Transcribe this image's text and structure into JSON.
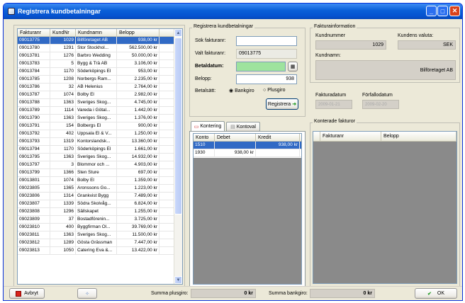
{
  "window": {
    "title": "Registrera kundbetalningar"
  },
  "invoice_list": {
    "headers": [
      "Fakturanr",
      "KundNr",
      "Kundnamn",
      "Belopp"
    ],
    "rows": [
      [
        "09013775",
        "1029",
        "Bilföretaget AB",
        "938,00 kr"
      ],
      [
        "09013780",
        "1291",
        "Stor Stockhol...",
        "562.500,00 kr"
      ],
      [
        "09013781",
        "1276",
        "Barbro Wedding",
        "50.000,00 kr"
      ],
      [
        "09013783",
        "5",
        "Bygg & Trä AB",
        "3.106,00 kr"
      ],
      [
        "09013784",
        "1170",
        "Söderköpings El",
        "953,00 kr"
      ],
      [
        "09013785",
        "1208",
        "Norbergs Ram...",
        "2.235,00 kr"
      ],
      [
        "09013786",
        "32",
        "AB Helenius",
        "2.764,00 kr"
      ],
      [
        "09013787",
        "1074",
        "Bolby El",
        "2.982,00 kr"
      ],
      [
        "09013788",
        "1363",
        "Sveriges Skog...",
        "4.745,00 kr"
      ],
      [
        "09013789",
        "1114",
        "Vareda i Götal...",
        "1.442,00 kr"
      ],
      [
        "09013790",
        "1363",
        "Sveriges Skog...",
        "1.376,00 kr"
      ],
      [
        "09013791",
        "154",
        "Bolbergs El",
        "900,00 kr"
      ],
      [
        "09013792",
        "402",
        "Uppsala El & V...",
        "1.250,00 kr"
      ],
      [
        "09013793",
        "1319",
        "Kontorslandsk...",
        "13.360,00 kr"
      ],
      [
        "09013794",
        "1170",
        "Söderköpings El",
        "1.661,00 kr"
      ],
      [
        "09013795",
        "1363",
        "Sveriges Skog...",
        "14.932,00 kr"
      ],
      [
        "09013797",
        "3",
        "Blommor och ...",
        "4.903,00 kr"
      ],
      [
        "09013799",
        "1366",
        "Sten Sture",
        "697,00 kr"
      ],
      [
        "09013801",
        "1074",
        "Bolby El",
        "1.359,00 kr"
      ],
      [
        "09023805",
        "1365",
        "Aronssons Go...",
        "1.223,00 kr"
      ],
      [
        "09023806",
        "1314",
        "Grankvist Bygg",
        "7.489,00 kr"
      ],
      [
        "09023807",
        "1339",
        "Södra Skolvåg...",
        "6.824,00 kr"
      ],
      [
        "09023808",
        "1296",
        "Sällskapet",
        "1.255,00 kr"
      ],
      [
        "09023809",
        "37",
        "Bostadförenin...",
        "3.725,00 kr"
      ],
      [
        "09023810",
        "400",
        "Byggfirman Ol...",
        "39.769,00 kr"
      ],
      [
        "09023811",
        "1363",
        "Sveriges Skog...",
        "11.500,00 kr"
      ],
      [
        "09023812",
        "1289",
        "Gösta Grässman",
        "7.447,00 kr"
      ],
      [
        "09023813",
        "1050",
        "Catering Eva &...",
        "13.422,00 kr"
      ]
    ]
  },
  "payment": {
    "group_title": "Registrera kundbetalningar",
    "search_label": "Sök fakturanr:",
    "search_value": "",
    "chosen_label": "Valt fakturanr:",
    "chosen_value": "09013775",
    "date_label": "Betaldatum:",
    "amount_label": "Belopp:",
    "amount_value": "938",
    "method_label": "Betalsätt:",
    "method_bankgiro": "Bankgiro",
    "method_plusgiro": "Plusgiro",
    "register_button": "Registrera"
  },
  "invoice_info": {
    "group_title": "Fakturainformation",
    "kundnummer_label": "Kundnummer",
    "kundnummer_value": "1029",
    "valuta_label": "Kundens valuta:",
    "valuta_value": "SEK",
    "kundnamn_label": "Kundnamn:",
    "kundnamn_value": "Bilföretaget AB",
    "fakturadatum_label": "Fakturadatum",
    "fakturadatum_value": "2009-01-21",
    "forfallo_label": "Förfallodatum",
    "forfallo_value": "2009-02-20"
  },
  "tabs": [
    "Kontering",
    "Kontoval"
  ],
  "kontering": {
    "headers": [
      "Konto",
      "Debet",
      "Kredit"
    ],
    "rows": [
      [
        "1510",
        "",
        "938,00 kr"
      ],
      [
        "1930",
        "938,00 kr",
        ""
      ]
    ]
  },
  "konterade": {
    "group_title": "Konterade fakturor",
    "headers": [
      "Fakturanr",
      "Belopp"
    ]
  },
  "bottom": {
    "cancel_label": "Avbryt",
    "sum_plusgiro_label": "Summa plusgiro:",
    "sum_plusgiro_value": "0 kr",
    "sum_bankgiro_label": "Summa bankgiro:",
    "sum_bankgiro_value": "0 kr",
    "ok_label": "OK"
  }
}
